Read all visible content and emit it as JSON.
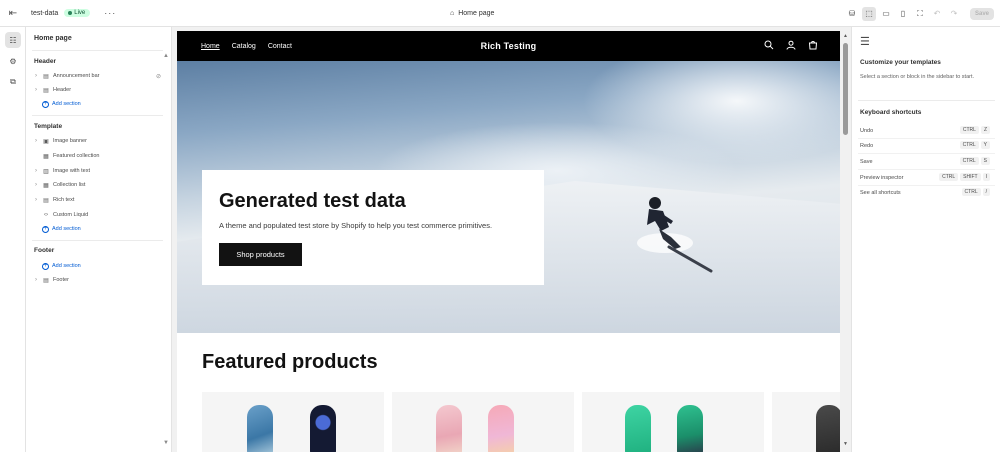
{
  "topbar": {
    "store_name": "test-data",
    "live_label": "Live",
    "page_selector": "Home page",
    "save_label": "Save"
  },
  "sidebar": {
    "title": "Home page",
    "header_group": "Header",
    "header_items": [
      {
        "label": "Announcement bar",
        "icon": "announcement-icon"
      },
      {
        "label": "Header",
        "icon": "header-layout-icon"
      }
    ],
    "add_section_label": "Add section",
    "template_group": "Template",
    "template_items": [
      {
        "label": "Image banner",
        "icon": "image-banner-icon"
      },
      {
        "label": "Featured collection",
        "icon": "collection-icon"
      },
      {
        "label": "Image with text",
        "icon": "image-text-icon"
      },
      {
        "label": "Collection list",
        "icon": "collection-list-icon"
      },
      {
        "label": "Rich text",
        "icon": "text-icon"
      },
      {
        "label": "Custom Liquid",
        "icon": "code-icon"
      }
    ],
    "footer_group": "Footer",
    "footer_items": [
      {
        "label": "Footer",
        "icon": "footer-layout-icon"
      }
    ]
  },
  "preview": {
    "nav_links": [
      "Home",
      "Catalog",
      "Contact"
    ],
    "brand": "Rich Testing",
    "hero_title": "Generated test data",
    "hero_subtitle": "A theme and populated test store by Shopify to help you test commerce primitives.",
    "hero_button": "Shop products",
    "featured_heading": "Featured products"
  },
  "right_panel": {
    "title": "Customize your templates",
    "text": "Select a section or block in the sidebar to start.",
    "shortcuts_title": "Keyboard shortcuts",
    "shortcuts": [
      {
        "action": "Undo",
        "keys": [
          "CTRL",
          "Z"
        ]
      },
      {
        "action": "Redo",
        "keys": [
          "CTRL",
          "Y"
        ]
      },
      {
        "action": "Save",
        "keys": [
          "CTRL",
          "S"
        ]
      },
      {
        "action": "Preview inspector",
        "keys": [
          "CTRL",
          "SHIFT",
          "I"
        ]
      },
      {
        "action": "See all shortcuts",
        "keys": [
          "CTRL",
          "/"
        ]
      }
    ]
  },
  "colors": {
    "accent_link": "#005bd3",
    "live_badge_bg": "#cdfee1",
    "nav_bg": "#000000",
    "button_bg": "#121212"
  }
}
